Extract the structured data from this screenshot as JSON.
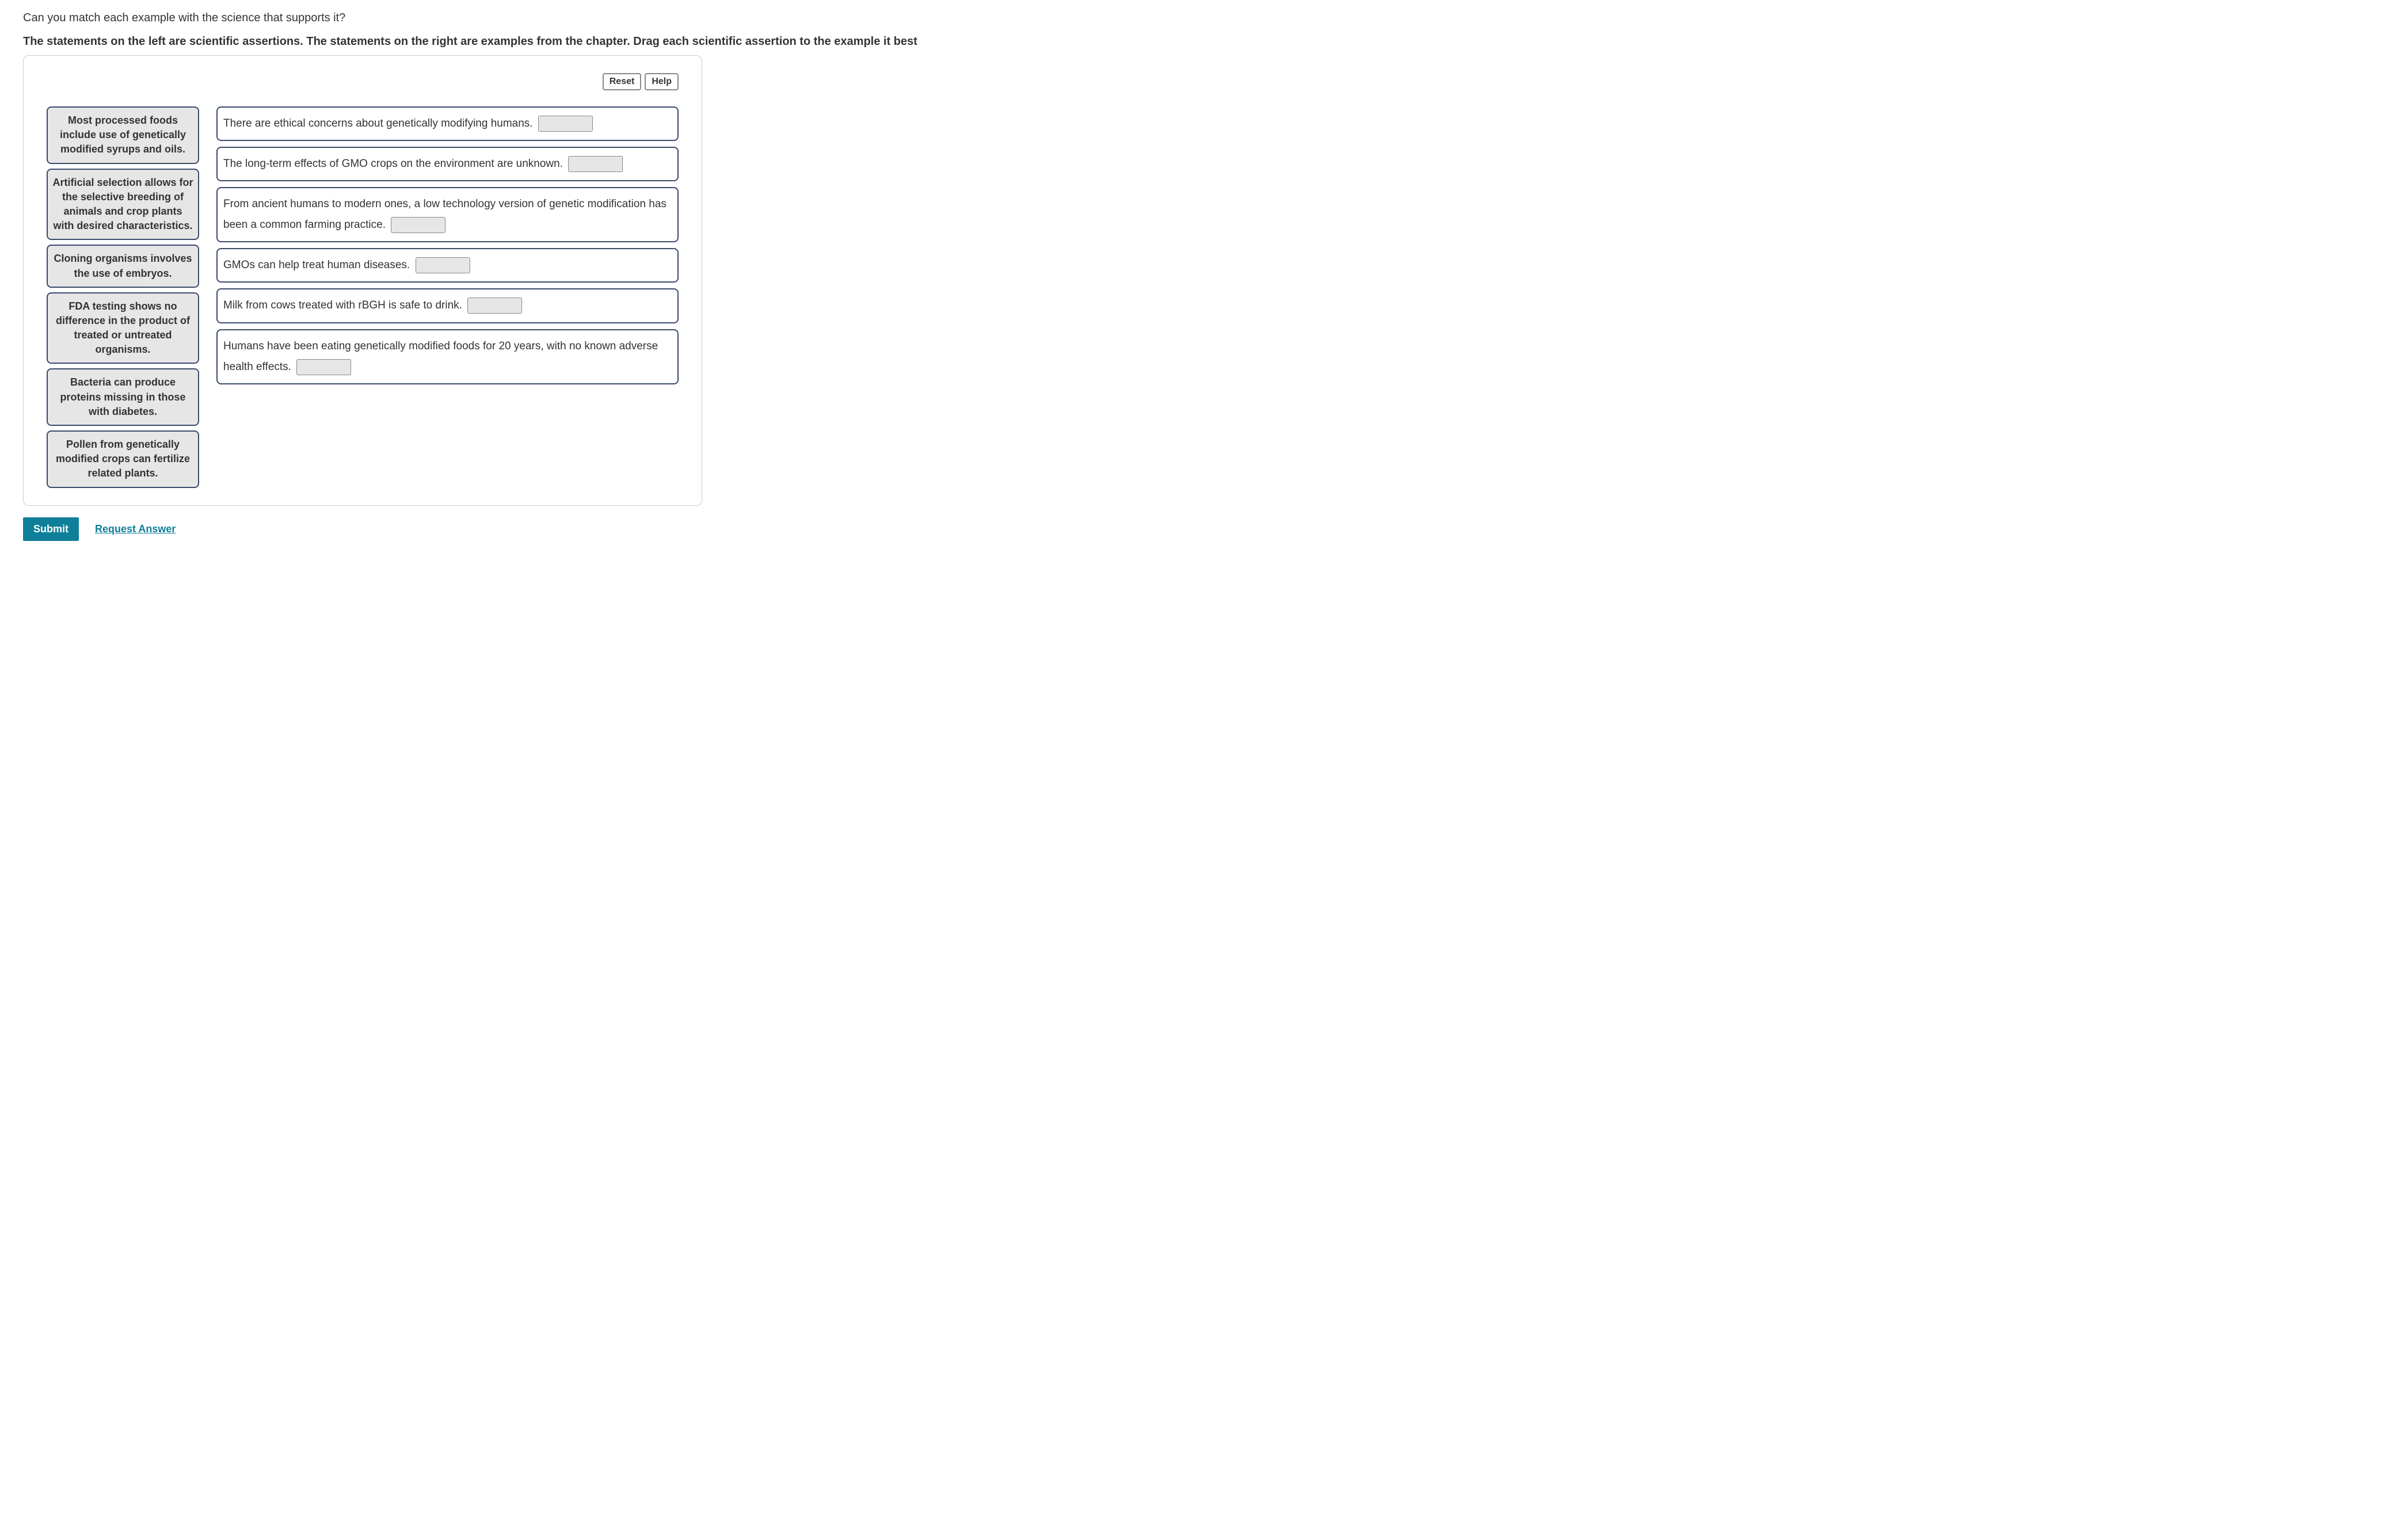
{
  "question": "Can you match each example with the science that supports it?",
  "instruction": "The statements on the left are scientific assertions. The statements on the right are examples from the chapter. Drag each scientific assertion to the example it best",
  "buttons": {
    "reset": "Reset",
    "help": "Help",
    "submit": "Submit",
    "request_answer": "Request Answer"
  },
  "assertions": [
    {
      "text": "Most processed foods include use of genetically modified syrups and oils."
    },
    {
      "text": "Artificial selection allows for the selective breeding of animals and crop plants with desired characteristics."
    },
    {
      "text": "Cloning organisms involves the use of embryos."
    },
    {
      "text": "FDA testing shows no difference in the product of treated or untreated organisms."
    },
    {
      "text": "Bacteria can produce proteins missing in those with diabetes."
    },
    {
      "text": "Pollen from genetically modified crops can fertilize related plants."
    }
  ],
  "targets": [
    {
      "text": "There are ethical concerns about genetically modifying humans."
    },
    {
      "text": "The long-term effects of GMO crops on the environment are unknown."
    },
    {
      "text": "From ancient humans to modern ones, a low technology version of genetic modification has been a common farming practice."
    },
    {
      "text": "GMOs can help treat human diseases."
    },
    {
      "text": "Milk from cows treated with rBGH is safe to drink."
    },
    {
      "text": "Humans have been eating genetically modified foods for 20 years, with no known adverse health effects."
    }
  ]
}
